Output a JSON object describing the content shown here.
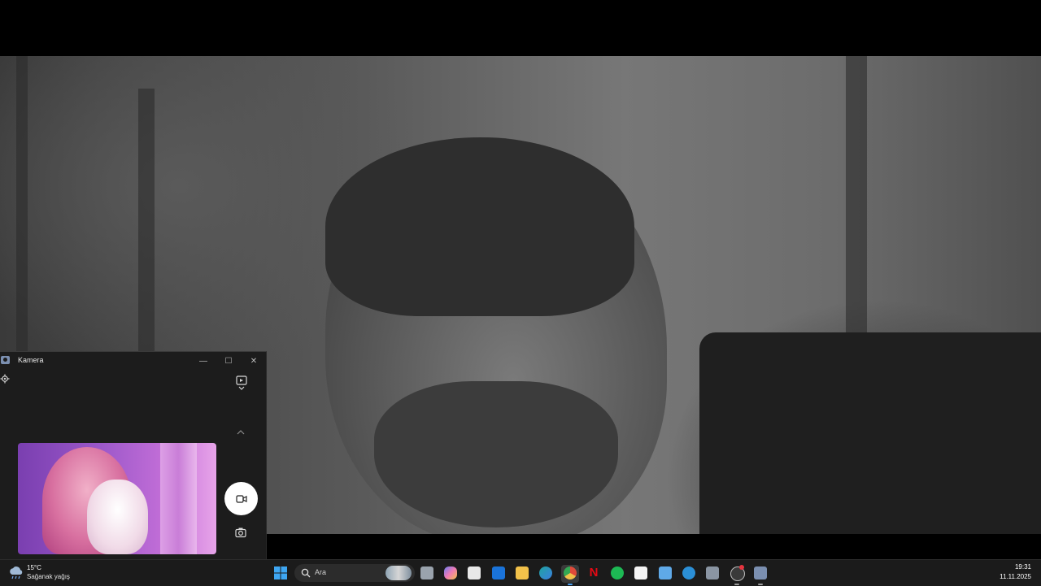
{
  "camera_window": {
    "title": "Kamera",
    "minimize_glyph": "—",
    "maximize_glyph": "☐",
    "close_glyph": "✕",
    "icons": {
      "settings": "gear-icon",
      "mode": "video-photo-toggle-icon",
      "expand": "chevron-up-icon",
      "record": "video-camera-icon",
      "photo": "camera-icon"
    }
  },
  "taskbar": {
    "weather": {
      "temp": "15°C",
      "description": "Sağanak yağış",
      "icon": "rain-cloud-icon"
    },
    "search": {
      "label": "Ara"
    },
    "apps": [
      {
        "name": "task-view-icon",
        "color": "#9aa3ad"
      },
      {
        "name": "copilot-icon",
        "color": "#6b7cf0"
      },
      {
        "name": "microsoft-store-icon",
        "color": "#e8e8e8"
      },
      {
        "name": "outlook-icon",
        "color": "#1a73d9"
      },
      {
        "name": "file-explorer-icon",
        "color": "#f2c14a"
      },
      {
        "name": "edge-icon",
        "color": "#1fa3a0"
      },
      {
        "name": "chrome-icon",
        "color": "#e04a3a"
      },
      {
        "name": "netflix-icon",
        "color": "#e50914"
      },
      {
        "name": "spotify-icon",
        "color": "#1db954"
      },
      {
        "name": "paint-icon",
        "color": "#f4f4f4"
      },
      {
        "name": "notepad-icon",
        "color": "#5fa9e8"
      },
      {
        "name": "edge-beta-icon",
        "color": "#2b8fd6"
      },
      {
        "name": "calculator-icon",
        "color": "#8a95a3"
      },
      {
        "name": "snipping-tool-icon",
        "color": "#d84a5a"
      },
      {
        "name": "camera-app-icon",
        "color": "#7b8fb0"
      }
    ],
    "clock": {
      "time": "19:31",
      "date": "11.11.2025"
    }
  }
}
